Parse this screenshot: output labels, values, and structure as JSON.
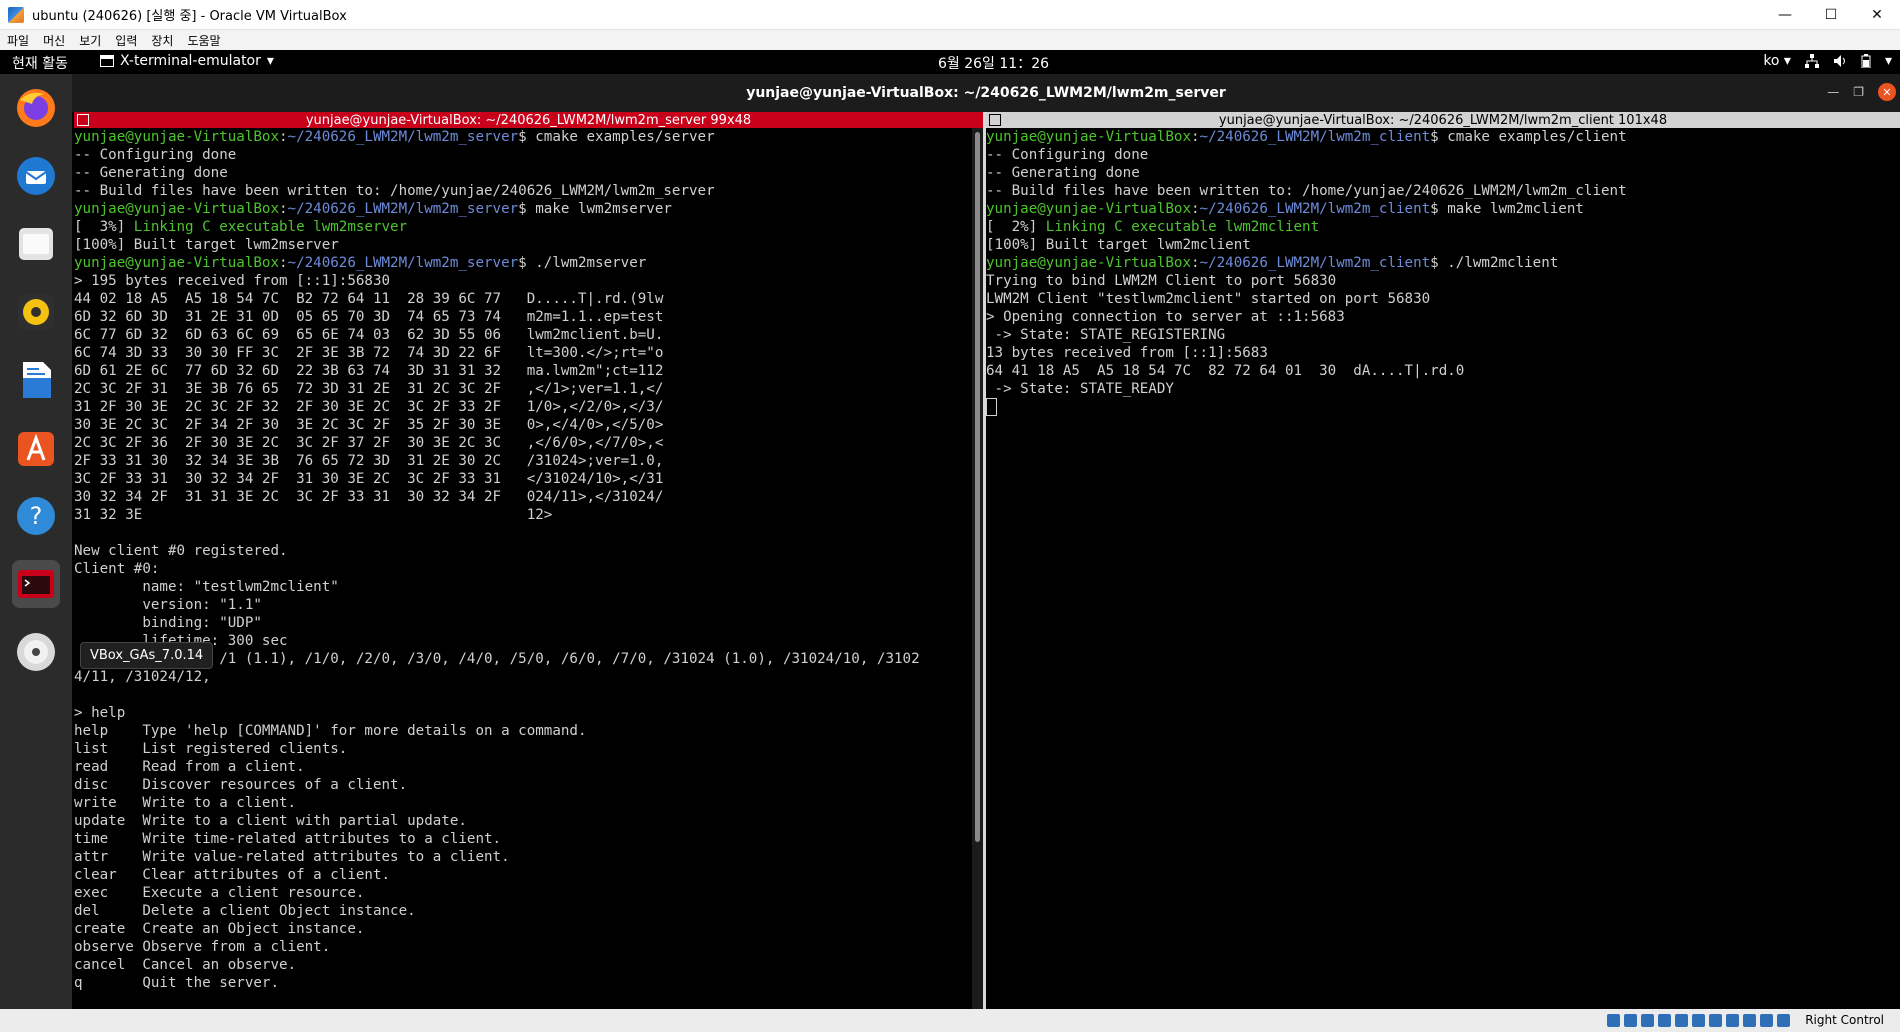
{
  "window": {
    "title": "ubuntu (240626) [실행 중] - Oracle VM VirtualBox",
    "controls": [
      "—",
      "☐",
      "✕"
    ]
  },
  "menu": [
    "파일",
    "머신",
    "보기",
    "입력",
    "장치",
    "도움말"
  ],
  "gnome": {
    "activities": "현재 활동",
    "app_menu": "X-terminal-emulator",
    "app_menu_arrow": "▾",
    "clock": "6월 26일  11：26",
    "lang": "ko ▾"
  },
  "dock": {
    "items": [
      "firefox-icon",
      "thunderbird-icon",
      "files-icon",
      "rhythmbox-icon",
      "writer-icon",
      "app-center-icon",
      "help-icon",
      "terminal-icon",
      "dvd-icon",
      "apps-grid-icon"
    ],
    "tooltip": "VBox_GAs_7.0.14"
  },
  "terminal": {
    "title": "yunjae@yunjae-VirtualBox: ~/240626_LWM2M/lwm2m_server",
    "left_header": "yunjae@yunjae-VirtualBox: ~/240626_LWM2M/lwm2m_server 99x48",
    "right_header": "yunjae@yunjae-VirtualBox: ~/240626_LWM2M/lwm2m_client 101x48"
  },
  "server_pane": {
    "lines": [
      [
        [
          "g",
          "yunjae@yunjae-VirtualBox"
        ],
        [
          "w",
          ":"
        ],
        [
          "b",
          "~/240626_LWM2M/lwm2m_server"
        ],
        [
          "w",
          "$ cmake examples/server"
        ]
      ],
      [
        [
          "w",
          "-- Configuring done"
        ]
      ],
      [
        [
          "w",
          "-- Generating done"
        ]
      ],
      [
        [
          "w",
          "-- Build files have been written to: /home/yunjae/240626_LWM2M/lwm2m_server"
        ]
      ],
      [
        [
          "g",
          "yunjae@yunjae-VirtualBox"
        ],
        [
          "w",
          ":"
        ],
        [
          "b",
          "~/240626_LWM2M/lwm2m_server"
        ],
        [
          "w",
          "$ make lwm2mserver"
        ]
      ],
      [
        [
          "w",
          "[  3%] "
        ],
        [
          "g",
          "Linking C executable lwm2mserver"
        ]
      ],
      [
        [
          "w",
          "[100%] Built target lwm2mserver"
        ]
      ],
      [
        [
          "g",
          "yunjae@yunjae-VirtualBox"
        ],
        [
          "w",
          ":"
        ],
        [
          "b",
          "~/240626_LWM2M/lwm2m_server"
        ],
        [
          "w",
          "$ ./lwm2mserver"
        ]
      ],
      [
        [
          "w",
          "> 195 bytes received from [::1]:56830"
        ]
      ],
      [
        [
          "w",
          "44 02 18 A5  A5 18 54 7C  B2 72 64 11  28 39 6C 77   D.....T|.rd.(9lw"
        ]
      ],
      [
        [
          "w",
          "6D 32 6D 3D  31 2E 31 0D  05 65 70 3D  74 65 73 74   m2m=1.1..ep=test"
        ]
      ],
      [
        [
          "w",
          "6C 77 6D 32  6D 63 6C 69  65 6E 74 03  62 3D 55 06   lwm2mclient.b=U."
        ]
      ],
      [
        [
          "w",
          "6C 74 3D 33  30 30 FF 3C  2F 3E 3B 72  74 3D 22 6F   lt=300.</>;rt=\"o"
        ]
      ],
      [
        [
          "w",
          "6D 61 2E 6C  77 6D 32 6D  22 3B 63 74  3D 31 31 32   ma.lwm2m\";ct=112"
        ]
      ],
      [
        [
          "w",
          "2C 3C 2F 31  3E 3B 76 65  72 3D 31 2E  31 2C 3C 2F   ,</1>;ver=1.1,</"
        ]
      ],
      [
        [
          "w",
          "31 2F 30 3E  2C 3C 2F 32  2F 30 3E 2C  3C 2F 33 2F   1/0>,</2/0>,</3/"
        ]
      ],
      [
        [
          "w",
          "30 3E 2C 3C  2F 34 2F 30  3E 2C 3C 2F  35 2F 30 3E   0>,</4/0>,</5/0>"
        ]
      ],
      [
        [
          "w",
          "2C 3C 2F 36  2F 30 3E 2C  3C 2F 37 2F  30 3E 2C 3C   ,</6/0>,</7/0>,<"
        ]
      ],
      [
        [
          "w",
          "2F 33 31 30  32 34 3E 3B  76 65 72 3D  31 2E 30 2C   /31024>;ver=1.0,"
        ]
      ],
      [
        [
          "w",
          "3C 2F 33 31  30 32 34 2F  31 30 3E 2C  3C 2F 33 31   </31024/10>,</31"
        ]
      ],
      [
        [
          "w",
          "30 32 34 2F  31 31 3E 2C  3C 2F 33 31  30 32 34 2F   024/11>,</31024/"
        ]
      ],
      [
        [
          "w",
          "31 32 3E                                             12>"
        ]
      ],
      [
        [
          "w",
          ""
        ]
      ],
      [
        [
          "w",
          "New client #0 registered."
        ]
      ],
      [
        [
          "w",
          "Client #0:"
        ]
      ],
      [
        [
          "w",
          "        name: \"testlwm2mclient\""
        ]
      ],
      [
        [
          "w",
          "        version: \"1.1\""
        ]
      ],
      [
        [
          "w",
          "        binding: \"UDP\""
        ]
      ],
      [
        [
          "w",
          "        lifetime: 300 sec"
        ]
      ],
      [
        [
          "w",
          "        objects: /1 (1.1), /1/0, /2/0, /3/0, /4/0, /5/0, /6/0, /7/0, /31024 (1.0), /31024/10, /3102"
        ]
      ],
      [
        [
          "w",
          "4/11, /31024/12,"
        ]
      ],
      [
        [
          "w",
          ""
        ]
      ],
      [
        [
          "w",
          "> help"
        ]
      ],
      [
        [
          "w",
          "help    Type 'help [COMMAND]' for more details on a command."
        ]
      ],
      [
        [
          "w",
          "list    List registered clients."
        ]
      ],
      [
        [
          "w",
          "read    Read from a client."
        ]
      ],
      [
        [
          "w",
          "disc    Discover resources of a client."
        ]
      ],
      [
        [
          "w",
          "write   Write to a client."
        ]
      ],
      [
        [
          "w",
          "update  Write to a client with partial update."
        ]
      ],
      [
        [
          "w",
          "time    Write time-related attributes to a client."
        ]
      ],
      [
        [
          "w",
          "attr    Write value-related attributes to a client."
        ]
      ],
      [
        [
          "w",
          "clear   Clear attributes of a client."
        ]
      ],
      [
        [
          "w",
          "exec    Execute a client resource."
        ]
      ],
      [
        [
          "w",
          "del     Delete a client Object instance."
        ]
      ],
      [
        [
          "w",
          "create  Create an Object instance."
        ]
      ],
      [
        [
          "w",
          "observe Observe from a client."
        ]
      ],
      [
        [
          "w",
          "cancel  Cancel an observe."
        ]
      ],
      [
        [
          "w",
          "q       Quit the server."
        ]
      ]
    ]
  },
  "client_pane": {
    "lines": [
      [
        [
          "g",
          "yunjae@yunjae-VirtualBox"
        ],
        [
          "w",
          ":"
        ],
        [
          "b",
          "~/240626_LWM2M/lwm2m_client"
        ],
        [
          "w",
          "$ cmake examples/client"
        ]
      ],
      [
        [
          "w",
          "-- Configuring done"
        ]
      ],
      [
        [
          "w",
          "-- Generating done"
        ]
      ],
      [
        [
          "w",
          "-- Build files have been written to: /home/yunjae/240626_LWM2M/lwm2m_client"
        ]
      ],
      [
        [
          "g",
          "yunjae@yunjae-VirtualBox"
        ],
        [
          "w",
          ":"
        ],
        [
          "b",
          "~/240626_LWM2M/lwm2m_client"
        ],
        [
          "w",
          "$ make lwm2mclient"
        ]
      ],
      [
        [
          "w",
          "[  2%] "
        ],
        [
          "g",
          "Linking C executable lwm2mclient"
        ]
      ],
      [
        [
          "w",
          "[100%] Built target lwm2mclient"
        ]
      ],
      [
        [
          "g",
          "yunjae@yunjae-VirtualBox"
        ],
        [
          "w",
          ":"
        ],
        [
          "b",
          "~/240626_LWM2M/lwm2m_client"
        ],
        [
          "w",
          "$ ./lwm2mclient"
        ]
      ],
      [
        [
          "w",
          "Trying to bind LWM2M Client to port 56830"
        ]
      ],
      [
        [
          "w",
          "LWM2M Client \"testlwm2mclient\" started on port 56830"
        ]
      ],
      [
        [
          "w",
          "> Opening connection to server at ::1:5683"
        ]
      ],
      [
        [
          "w",
          " -> State: STATE_REGISTERING"
        ]
      ],
      [
        [
          "w",
          "13 bytes received from [::1]:5683"
        ]
      ],
      [
        [
          "w",
          "64 41 18 A5  A5 18 54 7C  82 72 64 01  30  dA....T|.rd.0"
        ]
      ],
      [
        [
          "w",
          " -> State: STATE_READY"
        ]
      ]
    ]
  },
  "statusbar": {
    "host_key": "Right Control"
  }
}
